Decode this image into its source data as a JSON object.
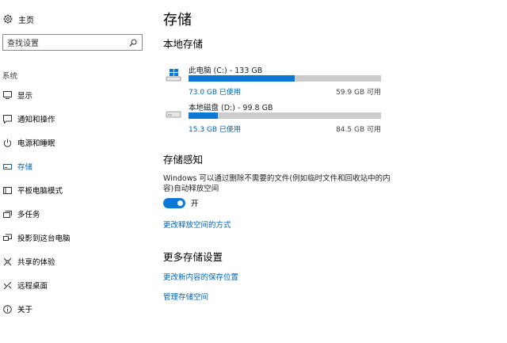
{
  "sidebar": {
    "home_label": "主页",
    "search_placeholder": "查找设置",
    "section_label": "系统",
    "items": [
      {
        "label": "显示",
        "icon": "display-icon"
      },
      {
        "label": "通知和操作",
        "icon": "notification-icon"
      },
      {
        "label": "电源和睡眠",
        "icon": "power-icon"
      },
      {
        "label": "存储",
        "icon": "storage-icon",
        "active": true
      },
      {
        "label": "平板电脑模式",
        "icon": "tablet-icon"
      },
      {
        "label": "多任务",
        "icon": "multitask-icon"
      },
      {
        "label": "投影到这台电脑",
        "icon": "project-icon"
      },
      {
        "label": "共享的体验",
        "icon": "share-icon"
      },
      {
        "label": "远程桌面",
        "icon": "remote-icon"
      },
      {
        "label": "关于",
        "icon": "info-icon"
      }
    ]
  },
  "main": {
    "title": "存储",
    "local_storage_heading": "本地存储",
    "drives": [
      {
        "name": "此电脑 (C:) - 133 GB",
        "used": "73.0 GB 已使用",
        "free": "59.9 GB 可用",
        "used_fraction": 0.55,
        "icon": "windows-drive-icon"
      },
      {
        "name": "本地磁盘 (D:) - 99.8 GB",
        "used": "15.3 GB 已使用",
        "free": "84.5 GB 可用",
        "used_fraction": 0.153,
        "icon": "hard-drive-icon"
      }
    ],
    "storage_sense": {
      "heading": "存储感知",
      "description": "Windows 可以通过删除不需要的文件(例如临时文件和回收站中的内容)自动释放空间",
      "toggle_state": "开",
      "toggle_on": true,
      "link": "更改释放空间的方式"
    },
    "more_settings": {
      "heading": "更多存储设置",
      "links": [
        "更改新内容的保存位置",
        "管理存储空间"
      ]
    }
  },
  "colors": {
    "accent": "#0a78d7",
    "link": "#0063b1",
    "bar_bg": "#cccccc"
  }
}
